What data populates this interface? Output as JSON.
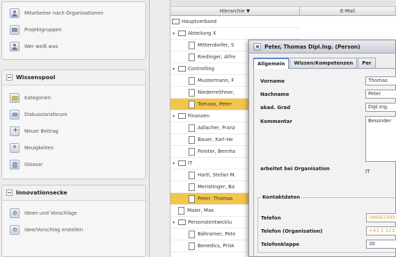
{
  "sidebar": {
    "section1": {
      "items": [
        {
          "label": "Mitarbeiter nach Organisationen",
          "icon": "person-icon"
        },
        {
          "label": "Projektgruppen",
          "icon": "group-icon"
        },
        {
          "label": "Wer weiß was",
          "icon": "person-icon"
        }
      ]
    },
    "section2": {
      "title": "Wissenspool",
      "items": [
        {
          "label": "Kategorien",
          "icon": "folder-icon"
        },
        {
          "label": "Diskussionsforum",
          "icon": "chat-icon"
        },
        {
          "label": "Neuer Beitrag",
          "icon": "plus-icon"
        },
        {
          "label": "Neuigkeiten",
          "icon": "star-icon"
        },
        {
          "label": "Glossar",
          "icon": "book-icon"
        }
      ]
    },
    "section3": {
      "title": "Innovationsecke",
      "items": [
        {
          "label": "Ideen und Vorschläge",
          "icon": "bulb-icon"
        },
        {
          "label": "Idee/Vorschlag erstellen",
          "icon": "bulb-icon"
        }
      ]
    }
  },
  "tree": {
    "columns": {
      "hierarchy": "Hierarchie ▼",
      "email": "E-Mail"
    },
    "rows": [
      {
        "label": "Hauptverband",
        "kind": "folder",
        "level": 0,
        "expander": ""
      },
      {
        "label": "Abteilung X",
        "kind": "folder",
        "level": 1,
        "expander": "▾"
      },
      {
        "label": "Mittendorfer, S",
        "kind": "doc",
        "level": 2,
        "expander": ""
      },
      {
        "label": "Riedinger, Alfre",
        "kind": "doc",
        "level": 2,
        "expander": ""
      },
      {
        "label": "Controlling",
        "kind": "folder",
        "level": 1,
        "expander": "▾"
      },
      {
        "label": "Mustermann, F",
        "kind": "doc",
        "level": 2,
        "expander": ""
      },
      {
        "label": "Niederreithner,",
        "kind": "doc",
        "level": 2,
        "expander": ""
      },
      {
        "label": "Tomaso, Peter",
        "kind": "doc",
        "level": 2,
        "expander": "",
        "selected": true
      },
      {
        "label": "Finanzen",
        "kind": "folder",
        "level": 1,
        "expander": "▾"
      },
      {
        "label": "Adlacher, Franz",
        "kind": "doc",
        "level": 2,
        "expander": ""
      },
      {
        "label": "Bauer, Karl-He",
        "kind": "doc",
        "level": 2,
        "expander": ""
      },
      {
        "label": "Pointer, Bernha",
        "kind": "doc",
        "level": 2,
        "expander": ""
      },
      {
        "label": "IT",
        "kind": "folder",
        "level": 1,
        "expander": "▾"
      },
      {
        "label": "Hartl, Stefan M.",
        "kind": "doc",
        "level": 2,
        "expander": ""
      },
      {
        "label": "Meristinger, Ba",
        "kind": "doc",
        "level": 2,
        "expander": ""
      },
      {
        "label": "Peter, Thomas",
        "kind": "doc",
        "level": 2,
        "expander": "",
        "selected": true
      },
      {
        "label": "Maier, Max",
        "kind": "doc",
        "level": 1,
        "expander": ""
      },
      {
        "label": "Personalentwicklu",
        "kind": "folder",
        "level": 1,
        "expander": "▾"
      },
      {
        "label": "Bähramer, Pete",
        "kind": "doc",
        "level": 2,
        "expander": ""
      },
      {
        "label": "Benedics, Prisk",
        "kind": "doc",
        "level": 2,
        "expander": ""
      }
    ]
  },
  "dialog": {
    "title": "Peter, Thomas Dipl.Ing. (Person)",
    "tabs": [
      "Allgemein",
      "Wissen/Kompetenzen",
      "Per"
    ],
    "fields": {
      "vorname_label": "Vorname",
      "vorname_value": "Thomas",
      "nachname_label": "Nachname",
      "nachname_value": "Peter",
      "grad_label": "akad. Grad",
      "grad_value": "Dipl.Ing.",
      "kommentar_label": "Kommentar",
      "kommentar_value": "Besonder",
      "org_label": "arbeitet bei Organisation",
      "org_value": "IT",
      "kontakt_title": "Kontaktdaten",
      "telefon_label": "Telefon",
      "telefon_value": "0664/2345",
      "telefon_org_label": "Telefon (Organisation)",
      "telefon_org_value": "+43 1 123",
      "klappe_label": "Telefonklappe",
      "klappe_value": "30"
    }
  },
  "colors": {
    "selection": "#f3c54a",
    "accent_phone": "#e0a043",
    "tab_active_border": "#5d7fc4"
  }
}
